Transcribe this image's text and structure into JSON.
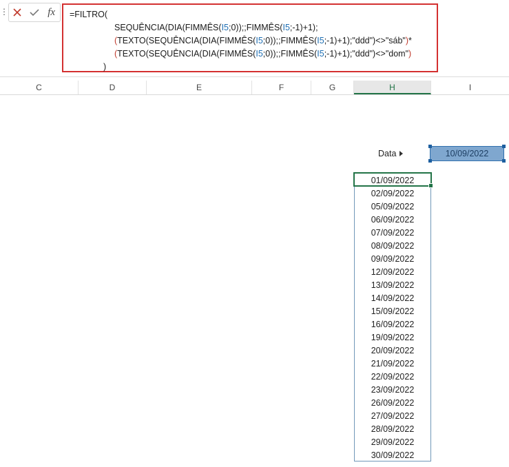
{
  "formula_bar": {
    "cancel_icon": "x-icon",
    "enter_icon": "check-icon",
    "fx_label": "fx",
    "lines": [
      "=FILTRO(",
      "SEQUÊNCIA(DIA(FIMMÊS(I5;0));;FIMMÊS(I5;-1)+1);",
      "(TEXTO(SEQUÊNCIA(DIA(FIMMÊS(I5;0));;FIMMÊS(I5;-1)+1);\"ddd\")<>\"sáb\")*",
      "(TEXTO(SEQUÊNCIA(DIA(FIMMÊS(I5;0));;FIMMÊS(I5;-1)+1);\"ddd\")<>\"dom\")",
      ")"
    ]
  },
  "columns": [
    "C",
    "D",
    "E",
    "F",
    "G",
    "H",
    "I"
  ],
  "active_column": "H",
  "data_label": "Data",
  "date_value": "10/09/2022",
  "dates": [
    "01/09/2022",
    "02/09/2022",
    "05/09/2022",
    "06/09/2022",
    "07/09/2022",
    "08/09/2022",
    "09/09/2022",
    "12/09/2022",
    "13/09/2022",
    "14/09/2022",
    "15/09/2022",
    "16/09/2022",
    "19/09/2022",
    "20/09/2022",
    "21/09/2022",
    "22/09/2022",
    "23/09/2022",
    "26/09/2022",
    "27/09/2022",
    "28/09/2022",
    "29/09/2022",
    "30/09/2022"
  ],
  "colors": {
    "formula_border": "#d32f2f",
    "cell_ref": "#1f6fb3",
    "active_green": "#217346",
    "date_fill": "#7fa7cf"
  }
}
